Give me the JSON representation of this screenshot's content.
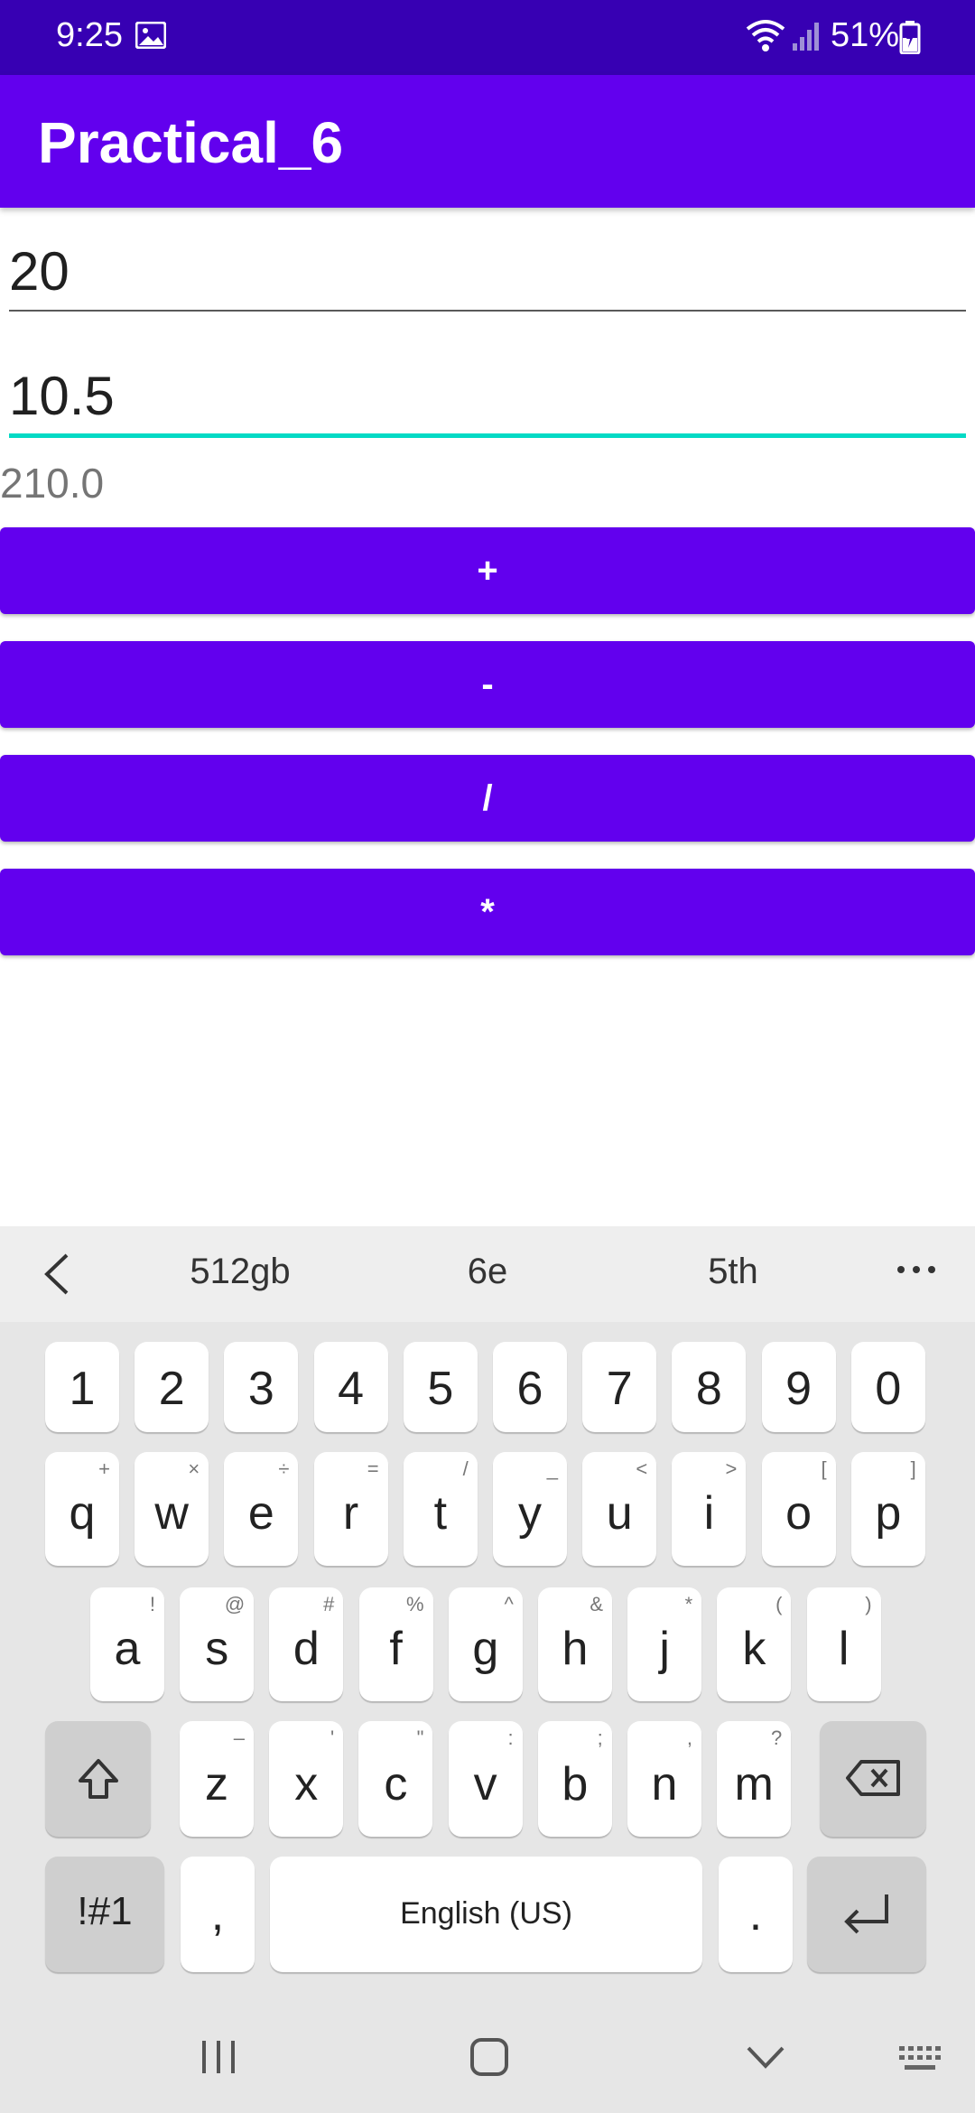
{
  "status": {
    "time": "9:25",
    "battery": "51%"
  },
  "app": {
    "title": "Practical_6"
  },
  "inputs": {
    "first": "20",
    "second": "10.5"
  },
  "result": "210.0",
  "buttons": {
    "add": "+",
    "subtract": "-",
    "divide": "/",
    "multiply": "*"
  },
  "colors": {
    "primary": "#6200ee",
    "primary_dark": "#3700b3",
    "accent": "#03dac5"
  },
  "keyboard": {
    "suggestions": [
      "512gb",
      "6e",
      "5th"
    ],
    "numbers": [
      "1",
      "2",
      "3",
      "4",
      "5",
      "6",
      "7",
      "8",
      "9",
      "0"
    ],
    "row1": [
      {
        "k": "q",
        "s": "+"
      },
      {
        "k": "w",
        "s": "×"
      },
      {
        "k": "e",
        "s": "÷"
      },
      {
        "k": "r",
        "s": "="
      },
      {
        "k": "t",
        "s": "/"
      },
      {
        "k": "y",
        "s": "_"
      },
      {
        "k": "u",
        "s": "<"
      },
      {
        "k": "i",
        "s": ">"
      },
      {
        "k": "o",
        "s": "["
      },
      {
        "k": "p",
        "s": "]"
      }
    ],
    "row2": [
      {
        "k": "a",
        "s": "!"
      },
      {
        "k": "s",
        "s": "@"
      },
      {
        "k": "d",
        "s": "#"
      },
      {
        "k": "f",
        "s": "%"
      },
      {
        "k": "g",
        "s": "^"
      },
      {
        "k": "h",
        "s": "&"
      },
      {
        "k": "j",
        "s": "*"
      },
      {
        "k": "k",
        "s": "("
      },
      {
        "k": "l",
        "s": ")"
      }
    ],
    "row3": [
      {
        "k": "z",
        "s": "–"
      },
      {
        "k": "x",
        "s": "'"
      },
      {
        "k": "c",
        "s": "\""
      },
      {
        "k": "v",
        "s": ":"
      },
      {
        "k": "b",
        "s": ";"
      },
      {
        "k": "n",
        "s": ","
      },
      {
        "k": "m",
        "s": "?"
      }
    ],
    "symbols_label": "!#1",
    "comma": ",",
    "space_label": "English (US)",
    "period": "."
  }
}
